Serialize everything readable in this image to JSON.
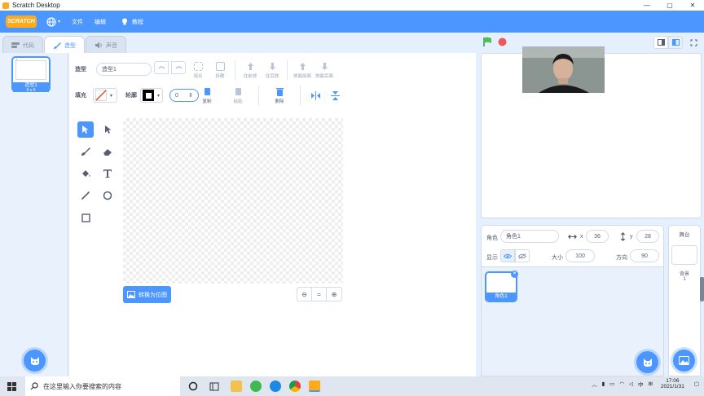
{
  "window": {
    "title": "Scratch Desktop",
    "controls": [
      "—",
      "▢",
      "✕"
    ]
  },
  "menubar": {
    "logo": "SCRATCH",
    "items": [
      {
        "icon": "globe-icon",
        "label": ""
      },
      {
        "label": "文件"
      },
      {
        "label": "编辑"
      },
      {
        "icon": "lightbulb-icon",
        "label": "教程"
      }
    ]
  },
  "tabs": [
    {
      "label": "代码",
      "icon": "code-icon"
    },
    {
      "label": "造型",
      "icon": "brush-icon",
      "active": true
    },
    {
      "label": "声音",
      "icon": "speaker-icon"
    }
  ],
  "costumes": [
    {
      "index": "1",
      "name": "造型1",
      "size": "0 x 0"
    }
  ],
  "editor": {
    "costume_label": "造型",
    "costume_name": "造型1",
    "fill_label": "填充",
    "outline_label": "轮廓",
    "outline_width": "0",
    "toolbar": [
      "组合",
      "拆散",
      "往前放",
      "往后放",
      "放最前面",
      "放最后面"
    ],
    "row2": [
      "复制",
      "粘贴",
      "删除"
    ],
    "convert_label": "转换为位图",
    "zoom": [
      "−",
      "=",
      "+"
    ]
  },
  "sprite_info": {
    "sprite_label": "角色",
    "sprite_name": "角色1",
    "x_label": "x",
    "x": "36",
    "y_label": "y",
    "y": "28",
    "show_label": "显示",
    "size_label": "大小",
    "size": "100",
    "direction_label": "方向",
    "direction": "90"
  },
  "sprites": [
    {
      "name": "角色1"
    }
  ],
  "stage_panel": {
    "title": "舞台",
    "backdrop_label": "背景",
    "backdrop_count": "1"
  },
  "taskbar": {
    "search_placeholder": "在这里输入你要搜索的内容",
    "time": "17:06",
    "date": "2021/1/31",
    "ime": "中"
  },
  "colors": {
    "accent": "#4c97ff",
    "scratch_orange": "#ffab19",
    "green_flag": "#4cbf56",
    "stop": "#ec5959"
  }
}
